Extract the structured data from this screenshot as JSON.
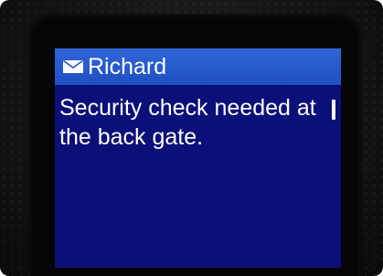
{
  "message": {
    "sender": "Richard",
    "body": "Security check needed at the back gate."
  },
  "icons": {
    "title": "envelope-icon"
  },
  "colors": {
    "screen_background": "#0b0f78",
    "title_bar": "#2456cc",
    "text": "#ffffff",
    "device_body": "#141414"
  }
}
